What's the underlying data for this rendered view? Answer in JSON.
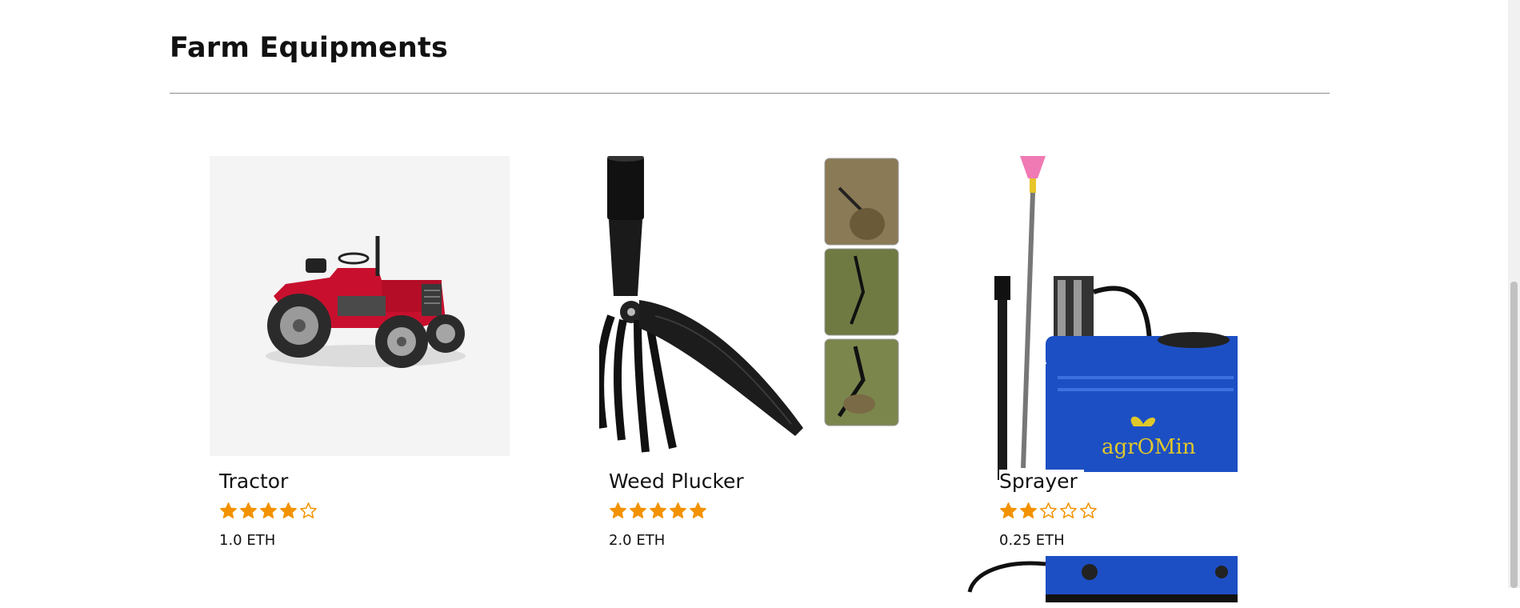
{
  "section": {
    "title": "Farm Equipments"
  },
  "products": [
    {
      "name": "Tractor",
      "rating": 4,
      "max_rating": 5,
      "price": "1.0 ETH",
      "image": "tractor-image"
    },
    {
      "name": "Weed Plucker",
      "rating": 5,
      "max_rating": 5,
      "price": "2.0 ETH",
      "image": "weed-plucker-image"
    },
    {
      "name": "Sprayer",
      "rating": 2,
      "max_rating": 5,
      "price": "0.25 ETH",
      "image": "sprayer-image"
    }
  ],
  "sprayer_brand": "agrOMin",
  "colors": {
    "star": "#f39200",
    "sprayer_blue": "#1d4fc4",
    "tractor_red": "#c8102e"
  }
}
